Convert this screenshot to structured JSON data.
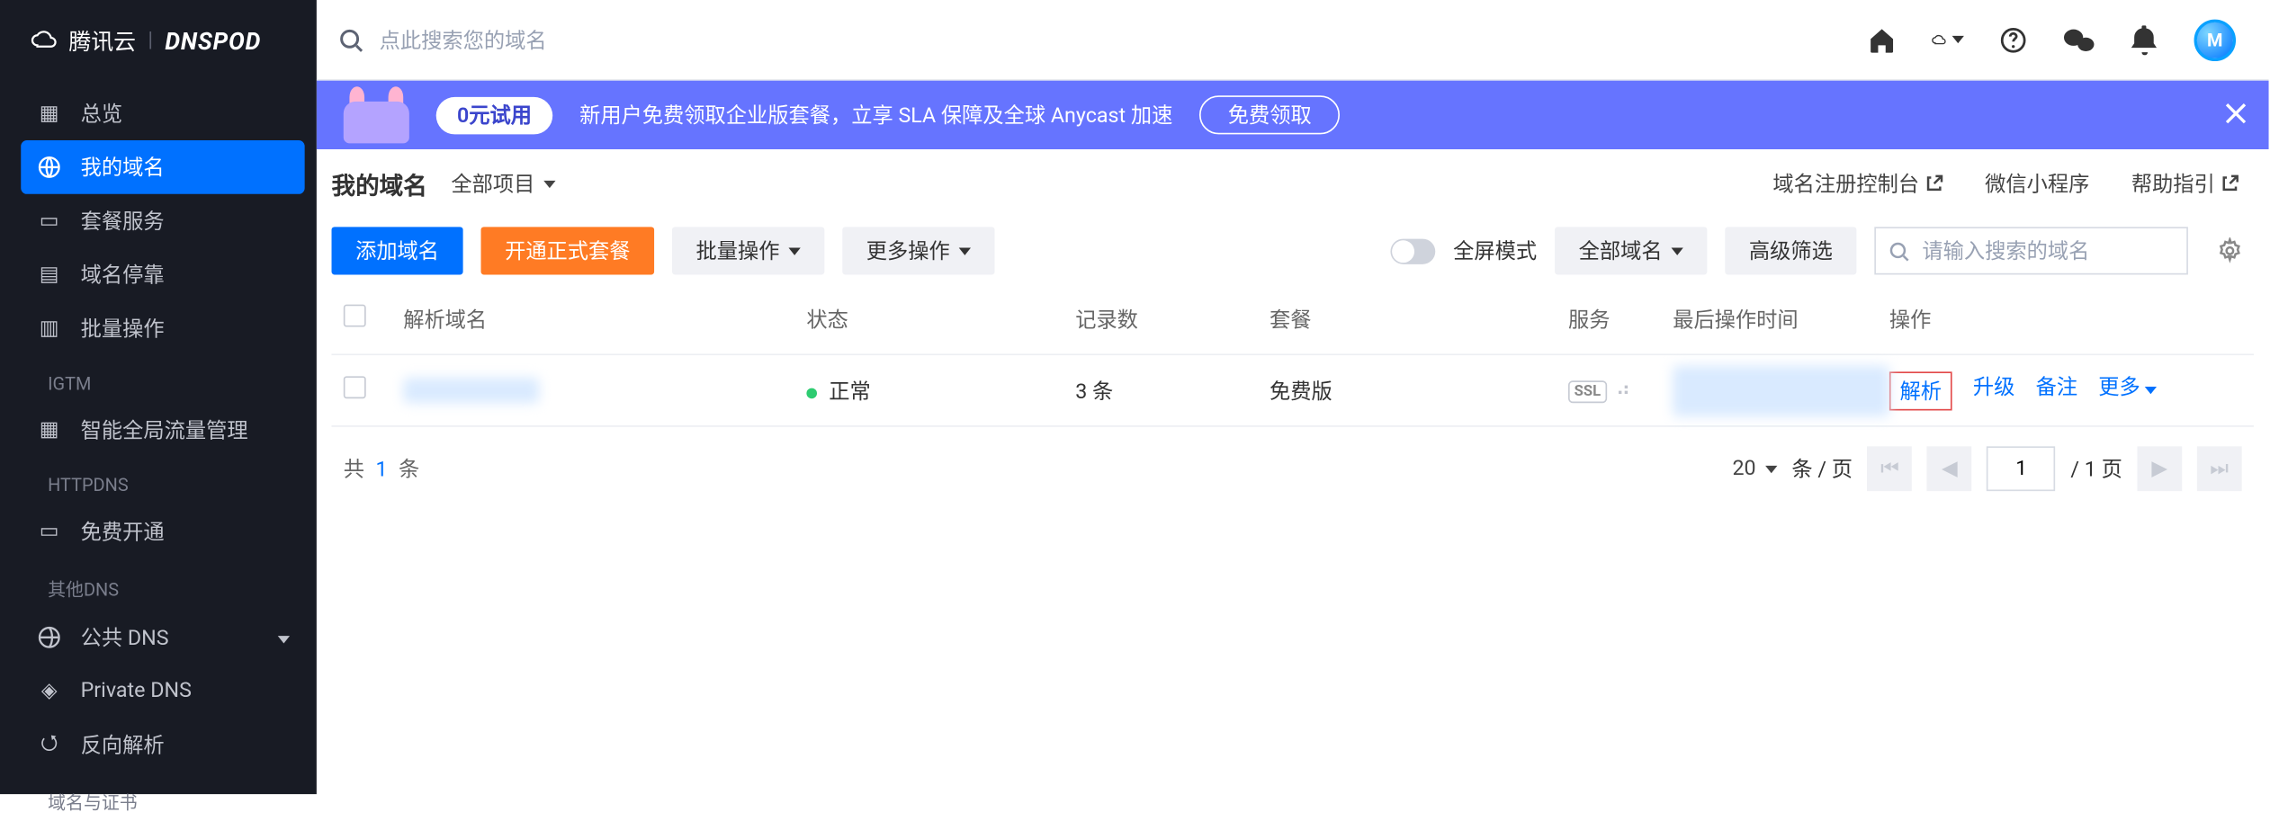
{
  "brand": {
    "cloud": "腾讯云",
    "dnspod": "DNSPOD"
  },
  "sidebar": {
    "overview": "总览",
    "my_domains": "我的域名",
    "plan_services": "套餐服务",
    "domain_parking": "域名停靠",
    "batch_ops": "批量操作",
    "igtm": "IGTM",
    "igtm_item": "智能全局流量管理",
    "httpdns": "HTTPDNS",
    "free_activate": "免费开通",
    "other_dns": "其他DNS",
    "public_dns": "公共 DNS",
    "private_dns": "Private DNS",
    "reverse_dns": "反向解析",
    "domain_cert": "域名与证书"
  },
  "topbar": {
    "search_placeholder": "点此搜索您的域名"
  },
  "banner": {
    "pill": "0元试用",
    "text": "新用户免费领取企业版套餐，立享 SLA 保障及全球 Anycast 加速",
    "cta": "免费领取"
  },
  "page": {
    "title": "我的域名",
    "project": "全部项目",
    "links": [
      "域名注册控制台",
      "微信小程序",
      "帮助指引"
    ]
  },
  "toolbar": {
    "add_domain": "添加域名",
    "activate_plan": "开通正式套餐",
    "batch_ops": "批量操作",
    "more_ops": "更多操作",
    "fullscreen": "全屏模式",
    "all_domains": "全部域名",
    "advanced_filter": "高级筛选",
    "search_placeholder": "请输入搜索的域名"
  },
  "table": {
    "headers": {
      "domain": "解析域名",
      "status": "状态",
      "records": "记录数",
      "plan": "套餐",
      "service": "服务",
      "last_op": "最后操作时间",
      "ops": "操作"
    },
    "rows": [
      {
        "domain": "████████",
        "status": "正常",
        "records": "3 条",
        "plan": "免费版",
        "service": "SSL",
        "last_op": "████-██-██ ██:██",
        "ops": [
          "解析",
          "升级",
          "备注",
          "更多"
        ]
      }
    ]
  },
  "footer": {
    "total_prefix": "共 ",
    "total": "1",
    "total_suffix": " 条",
    "page_size": "20",
    "per_page": "条 / 页",
    "page": "1",
    "pages": "1",
    "page_unit": "页"
  }
}
